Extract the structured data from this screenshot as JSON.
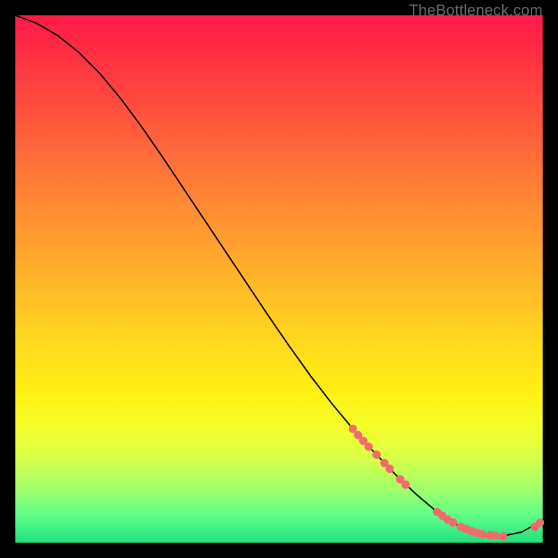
{
  "watermark": "TheBottleneck.com",
  "chart_data": {
    "type": "line",
    "title": "",
    "xlabel": "",
    "ylabel": "",
    "xlim": [
      0,
      100
    ],
    "ylim": [
      0,
      100
    ],
    "grid": false,
    "legend": false,
    "series": [
      {
        "name": "curve",
        "x": [
          0,
          4,
          8,
          12,
          16,
          20,
          24,
          28,
          32,
          36,
          40,
          44,
          48,
          52,
          56,
          60,
          64,
          68,
          72,
          76,
          80,
          84,
          88,
          92,
          96,
          100
        ],
        "y": [
          100,
          98.5,
          96.2,
          93.0,
          89.0,
          84.2,
          78.8,
          73.0,
          67.0,
          61.0,
          55.0,
          49.0,
          43.0,
          37.2,
          31.6,
          26.4,
          21.6,
          17.2,
          13.0,
          9.2,
          5.8,
          3.2,
          1.6,
          1.2,
          2.0,
          4.2
        ],
        "stroke": "#000000",
        "stroke_width": 2
      }
    ],
    "markers": [
      {
        "name": "dots",
        "color": "#f26b6b",
        "radius": 6,
        "points": [
          {
            "x": 64.0,
            "y": 21.6
          },
          {
            "x": 65.0,
            "y": 20.4
          },
          {
            "x": 66.0,
            "y": 19.3
          },
          {
            "x": 67.0,
            "y": 18.2
          },
          {
            "x": 68.5,
            "y": 16.7
          },
          {
            "x": 70.0,
            "y": 15.1
          },
          {
            "x": 71.0,
            "y": 14.0
          },
          {
            "x": 73.0,
            "y": 12.0
          },
          {
            "x": 74.0,
            "y": 11.0
          },
          {
            "x": 80.0,
            "y": 5.8
          },
          {
            "x": 81.0,
            "y": 5.1
          },
          {
            "x": 82.0,
            "y": 4.4
          },
          {
            "x": 83.0,
            "y": 3.8
          },
          {
            "x": 84.5,
            "y": 3.0
          },
          {
            "x": 85.5,
            "y": 2.6
          },
          {
            "x": 86.5,
            "y": 2.2
          },
          {
            "x": 87.5,
            "y": 1.9
          },
          {
            "x": 88.5,
            "y": 1.6
          },
          {
            "x": 90.0,
            "y": 1.4
          },
          {
            "x": 91.0,
            "y": 1.3
          },
          {
            "x": 92.5,
            "y": 1.2
          },
          {
            "x": 98.5,
            "y": 3.0
          },
          {
            "x": 99.5,
            "y": 3.8
          }
        ]
      }
    ]
  }
}
